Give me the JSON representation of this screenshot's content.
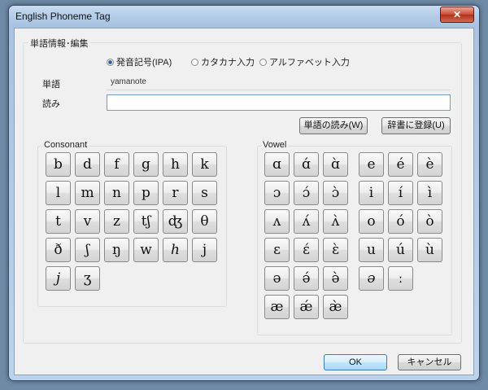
{
  "window": {
    "title": "English Phoneme Tag",
    "close_glyph": "✕"
  },
  "word_info": {
    "legend": "単語情報･編集",
    "radios": [
      {
        "label": "発音記号(IPA)",
        "checked": true
      },
      {
        "label": "カタカナ入力",
        "checked": false
      },
      {
        "label": "アルファベット入力",
        "checked": false
      }
    ],
    "word_label": "単語",
    "word_value": "yamanote",
    "reading_label": "読み",
    "reading_value": "",
    "read_button": "単語の読み(W)",
    "register_button": "辞書に登録(U)"
  },
  "consonant": {
    "legend": "Consonant",
    "keys": [
      "b",
      "d",
      "f",
      "g",
      "h",
      "k",
      "l",
      "m",
      "n",
      "p",
      "r",
      "s",
      "t",
      "v",
      "z",
      "tʃ",
      "ʤ",
      "θ",
      "ð",
      "ʃ",
      "ŋ",
      "w",
      "h",
      "j",
      "j",
      "ʒ"
    ],
    "italic_keys": [
      22,
      24
    ]
  },
  "vowel": {
    "legend": "Vowel",
    "left_keys": [
      "ɑ",
      "ɑ́",
      "ɑ̀",
      "ɔ",
      "ɔ́",
      "ɔ̀",
      "ʌ",
      "ʌ́",
      "ʌ̀",
      "ɛ",
      "ɛ́",
      "ɛ̀",
      "ə",
      "ə́",
      "ə̀",
      "æ",
      "ǽ",
      "æ̀"
    ],
    "right_keys": [
      "e",
      "é",
      "è",
      "i",
      "í",
      "ì",
      "o",
      "ó",
      "ò",
      "u",
      "ú",
      "ù",
      "ə",
      "ː"
    ],
    "right_italic_keys": [
      12
    ]
  },
  "footer": {
    "ok": "OK",
    "cancel": "キャンセル"
  }
}
